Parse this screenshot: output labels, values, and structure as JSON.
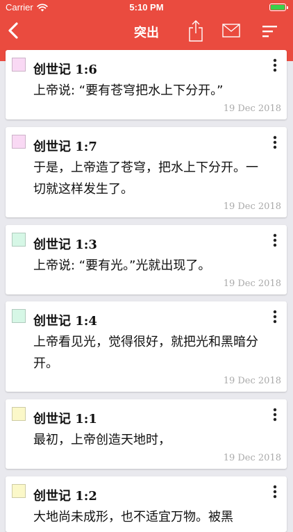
{
  "status_bar": {
    "carrier": "Carrier",
    "time": "5:10 PM"
  },
  "navbar": {
    "title": "突出"
  },
  "colors": {
    "header": "#ea4b3f",
    "pink": "#f9d9f4",
    "green": "#d6f7e6",
    "yellow": "#fbf8c9"
  },
  "highlights": [
    {
      "ref": "创世记 1:6",
      "text": "上帝说: “要有苍穹把水上下分开。”",
      "date": "19 Dec 2018",
      "color": "pink"
    },
    {
      "ref": "创世记 1:7",
      "text": "于是，上帝造了苍穹，把水上下分开。一切就这样发生了。",
      "date": "19 Dec 2018",
      "color": "pink"
    },
    {
      "ref": "创世记 1:3",
      "text": "上帝说: “要有光。”光就出现了。",
      "date": "19 Dec 2018",
      "color": "green"
    },
    {
      "ref": "创世记 1:4",
      "text": "上帝看见光，觉得很好，就把光和黑暗分开。",
      "date": "19 Dec 2018",
      "color": "green"
    },
    {
      "ref": "创世记 1:1",
      "text": "最初，上帝创造天地时，",
      "date": "19 Dec 2018",
      "color": "yellow"
    },
    {
      "ref": "创世记 1:2",
      "text": "大地尚未成形，也不适宜万物。被黑",
      "date": "",
      "color": "yellow"
    }
  ]
}
